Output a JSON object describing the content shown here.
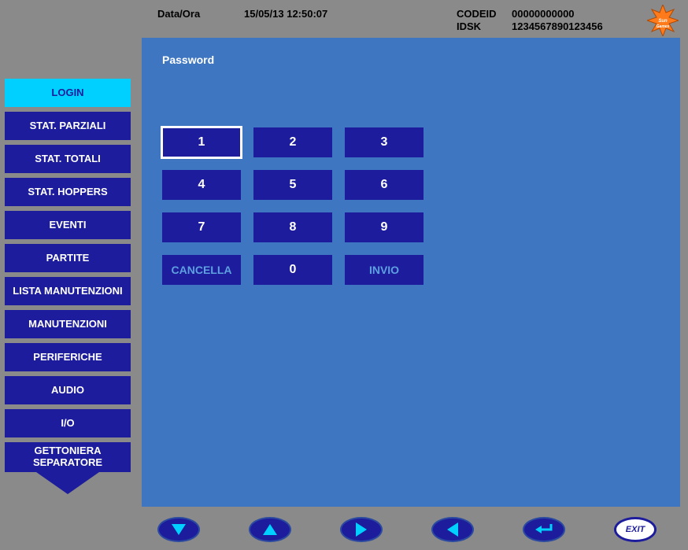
{
  "header": {
    "date_label": "Data/Ora",
    "date_value": "15/05/13  12:50:07",
    "codeid_label": "CODEID",
    "codeid_value": "00000000000",
    "idsk_label": "IDSK",
    "idsk_value": "1234567890123456",
    "logo_name": "SunGames"
  },
  "sidebar": {
    "items": [
      {
        "label": "LOGIN",
        "active": true
      },
      {
        "label": "STAT. PARZIALI",
        "active": false
      },
      {
        "label": "STAT. TOTALI",
        "active": false
      },
      {
        "label": "STAT. HOPPERS",
        "active": false
      },
      {
        "label": "EVENTI",
        "active": false
      },
      {
        "label": "PARTITE",
        "active": false
      },
      {
        "label": "LISTA MANUTENZIONI",
        "active": false
      },
      {
        "label": "MANUTENZIONI",
        "active": false
      },
      {
        "label": "PERIFERICHE",
        "active": false
      },
      {
        "label": "AUDIO",
        "active": false
      },
      {
        "label": "I/O",
        "active": false
      },
      {
        "label": "GETTONIERA SEPARATORE",
        "active": false
      }
    ]
  },
  "panel": {
    "title": "Password"
  },
  "keypad": {
    "k1": "1",
    "k2": "2",
    "k3": "3",
    "k4": "4",
    "k5": "5",
    "k6": "6",
    "k7": "7",
    "k8": "8",
    "k9": "9",
    "cancel": "CANCELLA",
    "k0": "0",
    "enter": "INVIO"
  },
  "footer": {
    "exit": "EXIT"
  }
}
